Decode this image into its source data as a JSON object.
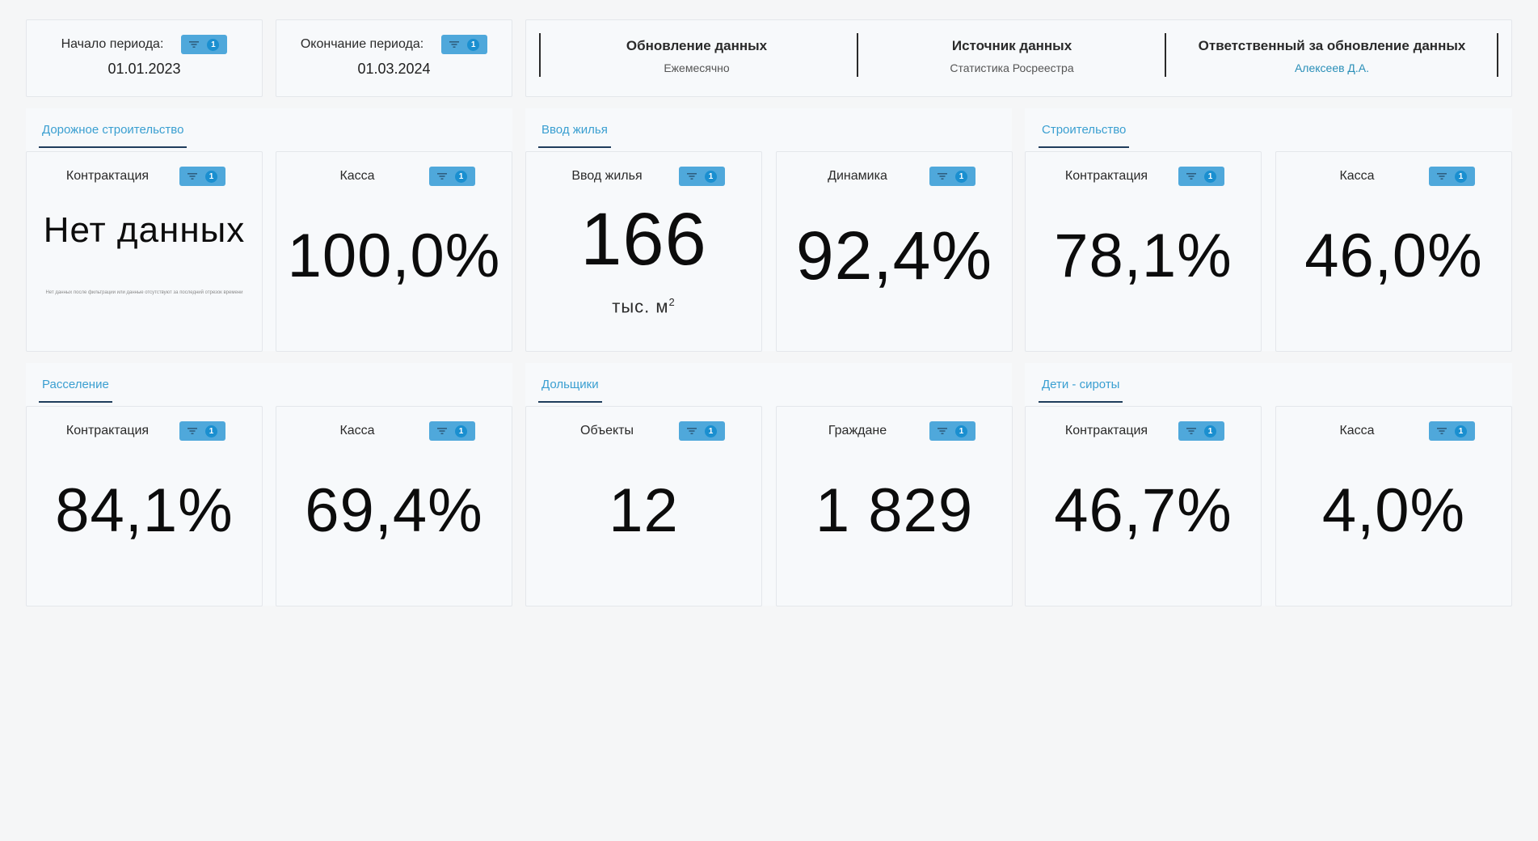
{
  "period": {
    "start_label": "Начало периода:",
    "start_value": "01.01.2023",
    "end_label": "Окончание периода:",
    "end_value": "01.03.2024",
    "filter_count": "1"
  },
  "info": {
    "update_title": "Обновление данных",
    "update_value": "Ежемесячно",
    "source_title": "Источник данных",
    "source_value": "Статистика Росреестра",
    "responsible_title": "Ответственный за обновление данных",
    "responsible_value": "Алексеев Д.А."
  },
  "sections": {
    "road": "Дорожное строительство",
    "housing": "Ввод жилья",
    "construction": "Строительство",
    "resettlement": "Расселение",
    "shareholders": "Дольщики",
    "orphans": "Дети - сироты"
  },
  "kpis": {
    "road_contract": {
      "label": "Контрактация",
      "value": "Нет данных",
      "note": "Нет данных после фильтрации или данные отсутствуют за последний отрезок времени"
    },
    "road_cash": {
      "label": "Касса",
      "value": "100,0%"
    },
    "housing_input": {
      "label": "Ввод жилья",
      "value": "166",
      "unit": "тыс. м",
      "unit_sup": "2"
    },
    "housing_dynamics": {
      "label": "Динамика",
      "value": "92,4%"
    },
    "construction_contract": {
      "label": "Контрактация",
      "value": "78,1%"
    },
    "construction_cash": {
      "label": "Касса",
      "value": "46,0%"
    },
    "resettlement_contract": {
      "label": "Контрактация",
      "value": "84,1%"
    },
    "resettlement_cash": {
      "label": "Касса",
      "value": "69,4%"
    },
    "shareholders_objects": {
      "label": "Объекты",
      "value": "12"
    },
    "shareholders_citizens": {
      "label": "Граждане",
      "value": "1 829"
    },
    "orphans_contract": {
      "label": "Контрактация",
      "value": "46,7%"
    },
    "orphans_cash": {
      "label": "Касса",
      "value": "4,0%"
    }
  },
  "colors": {
    "chip": "#4fa8db",
    "chip_badge": "#1a8fd0",
    "tab_text": "#3a9fd1",
    "tab_underline": "#1f3d5c",
    "link": "#2a8fb8"
  },
  "icons": {
    "filter": "filter-icon"
  }
}
